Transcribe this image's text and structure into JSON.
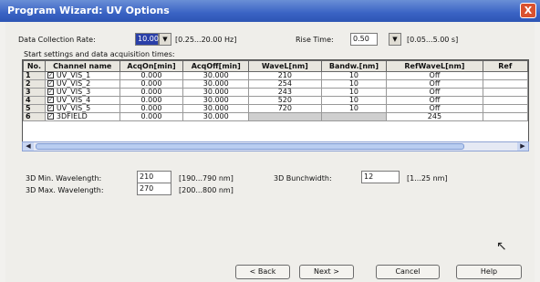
{
  "window": {
    "title": "Program Wizard: UV Options",
    "close_glyph": "X"
  },
  "form": {
    "data_collection_rate": {
      "label": "Data Collection Rate:",
      "value": "10.00",
      "range": "[0.25...20.00 Hz]"
    },
    "rise_time": {
      "label": "Rise Time:",
      "value": "0.50",
      "range": "[0.05...5.00 s]"
    },
    "section_label": "Start settings and data acquisition times:"
  },
  "table": {
    "columns": [
      "No.",
      "Channel name",
      "AcqOn[min]",
      "AcqOff[min]",
      "WaveL[nm]",
      "Bandw.[nm]",
      "RefWaveL[nm]",
      "Ref"
    ],
    "rows": [
      {
        "no": "1",
        "name": "UV_VIS_1",
        "on": "0.000",
        "off": "30.000",
        "wavel": "210",
        "bandw": "10",
        "ref": "Off"
      },
      {
        "no": "2",
        "name": "UV_VIS_2",
        "on": "0.000",
        "off": "30.000",
        "wavel": "254",
        "bandw": "10",
        "ref": "Off"
      },
      {
        "no": "3",
        "name": "UV_VIS_3",
        "on": "0.000",
        "off": "30.000",
        "wavel": "243",
        "bandw": "10",
        "ref": "Off"
      },
      {
        "no": "4",
        "name": "UV_VIS_4",
        "on": "0.000",
        "off": "30.000",
        "wavel": "520",
        "bandw": "10",
        "ref": "Off"
      },
      {
        "no": "5",
        "name": "UV_VIS_5",
        "on": "0.000",
        "off": "30.000",
        "wavel": "720",
        "bandw": "10",
        "ref": "Off"
      },
      {
        "no": "6",
        "name": "3DFIELD",
        "on": "0.000",
        "off": "30.000",
        "wavel": "",
        "bandw": "",
        "ref": "245"
      }
    ]
  },
  "wavelength": {
    "min": {
      "label": "3D Min. Wavelength:",
      "value": "210",
      "range": "[190...790 nm]"
    },
    "max": {
      "label": "3D Max. Wavelength:",
      "value": "270",
      "range": "[200...800 nm]"
    },
    "bunch": {
      "label": "3D Bunchwidth:",
      "value": "12",
      "range": "[1...25 nm]"
    }
  },
  "buttons": {
    "back": "< Back",
    "next": "Next >",
    "cancel": "Cancel",
    "help": "Help"
  },
  "colors": {
    "titlebar": "#3a63c4",
    "selection": "#2a3fa8",
    "close": "#d9522f"
  }
}
